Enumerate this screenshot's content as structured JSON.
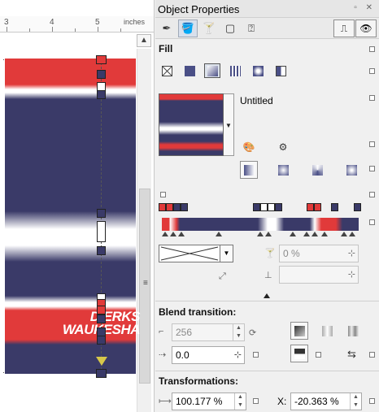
{
  "ruler": {
    "numbers": [
      "3",
      "4",
      "5"
    ],
    "unit": "inches"
  },
  "artwork": {
    "logo_line1": "DIERKS",
    "logo_line2": "WAUKESHA",
    "colors": {
      "red": "#e13a3a",
      "navy": "#3a3a68",
      "white": "#ffffff",
      "handle_yellow": "#d7c74a"
    }
  },
  "panel": {
    "title": "Object Properties",
    "fill_label": "Fill",
    "fill_name": "Untitled",
    "blend_label": "Blend transition:",
    "blend_steps": "256",
    "acceleration": "0.0",
    "transparency_value": "0 %",
    "transformations_label": "Transformations:",
    "scale_value": "100.177 %",
    "x_label": "X:",
    "x_value": "-20.363 %"
  }
}
